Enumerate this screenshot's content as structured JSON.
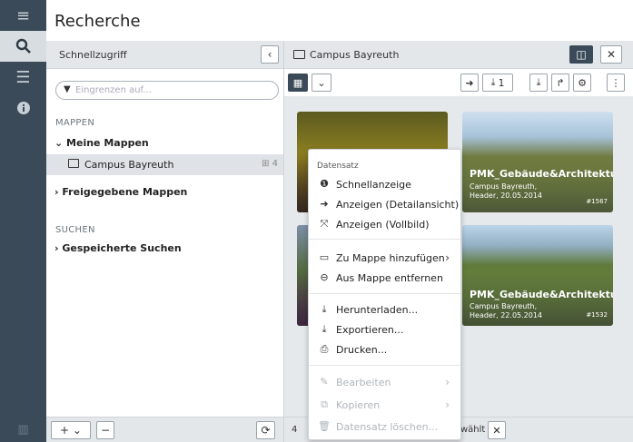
{
  "rail": {
    "icons": [
      "menu-icon",
      "search-icon",
      "list-icon",
      "info-icon"
    ]
  },
  "header": {
    "title": "Recherche"
  },
  "quick_access": {
    "title": "Schnellzugriff",
    "filter_placeholder": "Eingrenzen auf...",
    "section_folders": "MAPPEN",
    "my_folders": "Meine Mappen",
    "selected_folder": {
      "label": "Campus Bayreuth",
      "count": "4"
    },
    "shared_folders": "Freigegebene Mappen",
    "section_search": "SUCHEN",
    "saved_searches": "Gespeicherte Suchen"
  },
  "folder_view": {
    "title": "Campus Bayreuth",
    "download_count": "1",
    "footer_count": "4",
    "footer_selected": "wählt"
  },
  "cards": [
    {
      "title": "PMK_Gebäude&Architektur",
      "line1": "Campus Bayreuth,",
      "line2": "Header, 20.05.2014",
      "id": "#1567"
    },
    {
      "title": "PMK_Gebäude&Architektur",
      "line1": "Campus Bayreuth,",
      "line2": "Header, 22.05.2014",
      "id": "#1532"
    }
  ],
  "context_menu": {
    "header": "Datensatz",
    "items": [
      {
        "label": "Schnellanzeige",
        "icon": "info-icon"
      },
      {
        "label": "Anzeigen (Detailansicht)",
        "icon": "arrow-right-circle-icon"
      },
      {
        "label": "Anzeigen (Vollbild)",
        "icon": "fullscreen-icon"
      },
      {
        "label": "Zu Mappe hinzufügen",
        "icon": "folder-open-icon"
      },
      {
        "label": "Aus Mappe entfernen",
        "icon": "minus-circle-icon"
      },
      {
        "label": "Herunterladen...",
        "icon": "download-icon"
      },
      {
        "label": "Exportieren...",
        "icon": "export-icon"
      },
      {
        "label": "Drucken...",
        "icon": "print-icon"
      },
      {
        "label": "Bearbeiten",
        "icon": "pencil-icon"
      },
      {
        "label": "Kopieren",
        "icon": "copy-icon"
      },
      {
        "label": "Datensatz löschen...",
        "icon": "trash-icon"
      }
    ]
  }
}
